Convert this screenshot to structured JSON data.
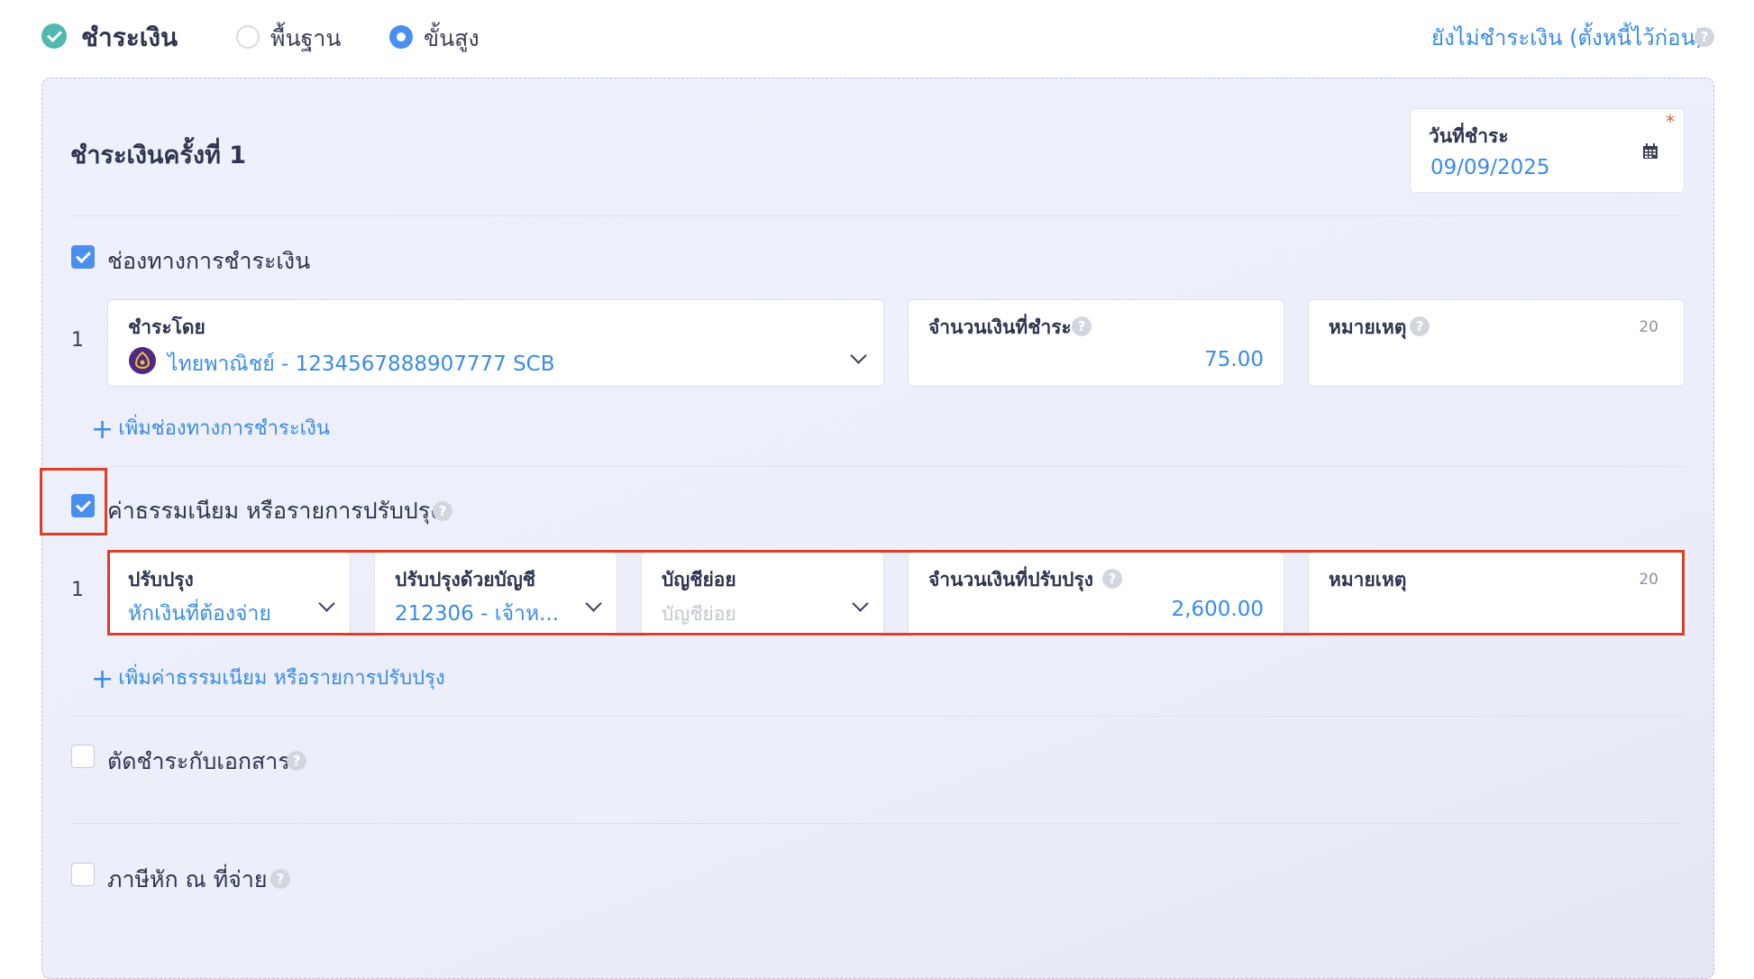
{
  "header": {
    "title": "ชำระเงิน",
    "mode_basic": "พื้นฐาน",
    "mode_advanced": "ขั้นสูง",
    "selected_mode": "advanced",
    "unpaid_link": "ยังไม่ชำระเงิน (ตั้งหนี้ไว้ก่อน)"
  },
  "payment": {
    "title": "ชำระเงินครั้งที่ 1",
    "date_label": "วันที่ชำระ",
    "date_value": "09/09/2025",
    "required_mark": "*"
  },
  "channels": {
    "checked": true,
    "label": "ช่องทางการชำระเงิน",
    "rows": [
      {
        "index": "1",
        "pay_by_label": "ชำระโดย",
        "pay_by_value": "ไทยพาณิชย์ - 1234567888907777 SCB",
        "amount_label": "จำนวนเงินที่ชำระ",
        "amount_value": "75.00",
        "note_label": "หมายเหตุ",
        "note_counter": "20"
      }
    ],
    "add_label": "เพิ่มช่องทางการชำระเงิน"
  },
  "fees": {
    "checked": true,
    "label": "ค่าธรรมเนียม หรือรายการปรับปรุง",
    "rows": [
      {
        "index": "1",
        "adjust_label": "ปรับปรุง",
        "adjust_value": "หักเงินที่ต้องจ่าย",
        "account_label": "ปรับปรุงด้วยบัญชี",
        "account_value": "212306 - เจ้าห...",
        "sub_label": "บัญชีย่อย",
        "sub_placeholder": "บัญชีย่อย",
        "amount_label": "จำนวนเงินที่ปรับปรุง",
        "amount_value": "2,600.00",
        "note_label": "หมายเหตุ",
        "note_counter": "20"
      }
    ],
    "add_label": "เพิ่มค่าธรรมเนียม หรือรายการปรับปรุง"
  },
  "offset": {
    "checked": false,
    "label": "ตัดชำระกับเอกสาร"
  },
  "wht": {
    "checked": false,
    "label": "ภาษีหัก ณ ที่จ่าย"
  },
  "icons": {
    "help": "?",
    "plus": "+"
  },
  "colors": {
    "accent": "#4a8ff0",
    "link": "#3a8be8",
    "highlight": "#e03c28",
    "success": "#4fb8b0"
  }
}
